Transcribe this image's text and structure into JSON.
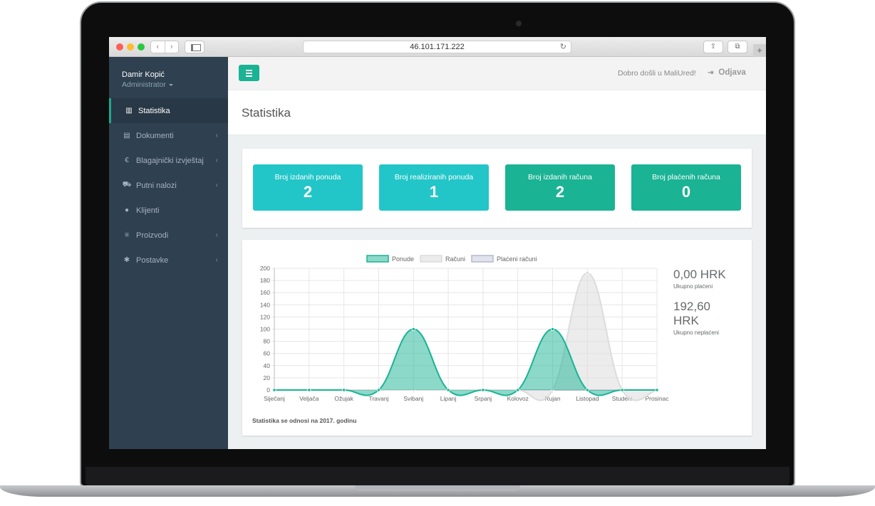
{
  "browser": {
    "url": "46.101.171.222",
    "nav_back": "‹",
    "nav_forward": "›",
    "reload": "↻",
    "share": "⇧",
    "tabs": "⧉",
    "new_tab": "+"
  },
  "sidebar": {
    "user_name": "Damir Kopić",
    "user_role": "Administrator",
    "items": [
      {
        "label": "Statistika",
        "icon": "bar-chart-icon",
        "glyph": "▥",
        "active": true,
        "has_submenu": false
      },
      {
        "label": "Dokumenti",
        "icon": "document-icon",
        "glyph": "▤",
        "active": false,
        "has_submenu": true
      },
      {
        "label": "Blagajnički izvještaj",
        "icon": "euro-icon",
        "glyph": "€",
        "active": false,
        "has_submenu": true
      },
      {
        "label": "Putni nalozi",
        "icon": "car-icon",
        "glyph": "⛟",
        "active": false,
        "has_submenu": true
      },
      {
        "label": "Klijenti",
        "icon": "user-circle-icon",
        "glyph": "●",
        "active": false,
        "has_submenu": false
      },
      {
        "label": "Proizvodi",
        "icon": "list-icon",
        "glyph": "≡",
        "active": false,
        "has_submenu": true
      },
      {
        "label": "Postavke",
        "icon": "gear-icon",
        "glyph": "✱",
        "active": false,
        "has_submenu": true
      }
    ],
    "chevron": "‹"
  },
  "header": {
    "welcome": "Dobro došli u MaliUred!",
    "logout_label": "Odjava",
    "logout_icon": "⇥"
  },
  "page": {
    "title": "Statistika"
  },
  "stats": [
    {
      "label": "Broj izdanih ponuda",
      "value": "2",
      "color": "#23c6c8"
    },
    {
      "label": "Broj realiziranih ponuda",
      "value": "1",
      "color": "#23c6c8"
    },
    {
      "label": "Broj izdanih računa",
      "value": "2",
      "color": "#1ab394"
    },
    {
      "label": "Broj plaćenih računa",
      "value": "0",
      "color": "#1ab394"
    }
  ],
  "summary": {
    "paid_value": "0,00 HRK",
    "paid_label": "Ukupno plaćeni",
    "unpaid_value_line1": "192,60",
    "unpaid_value_line2": "HRK",
    "unpaid_label": "Ukupno neplaćeni"
  },
  "chart_note": "Statistika se odnosi na 2017. godinu",
  "chart_data": {
    "type": "area",
    "categories": [
      "Siječanj",
      "Veljača",
      "Ožujak",
      "Travanj",
      "Svibanj",
      "Lipanj",
      "Srpanj",
      "Kolovoz",
      "Rujan",
      "Listopad",
      "Studeni",
      "Prosinac"
    ],
    "series": [
      {
        "name": "Ponude",
        "values": [
          0,
          0,
          0,
          0,
          100,
          0,
          0,
          0,
          100,
          0,
          0,
          0
        ],
        "color": "#1ab394"
      },
      {
        "name": "Računi",
        "values": [
          0,
          0,
          0,
          0,
          0,
          0,
          0,
          0,
          0,
          192.6,
          0,
          0
        ],
        "color": "#dcdcdc"
      },
      {
        "name": "Plaćeni računi",
        "values": [
          0,
          0,
          0,
          0,
          0,
          0,
          0,
          0,
          0,
          0,
          0,
          0
        ],
        "color": "#b5b8cf"
      }
    ],
    "yticks": [
      "0",
      "20",
      "40",
      "60",
      "80",
      "100",
      "120",
      "140",
      "160",
      "180",
      "200"
    ],
    "ylim": [
      0,
      200
    ],
    "grid": true,
    "legend_position": "top"
  }
}
